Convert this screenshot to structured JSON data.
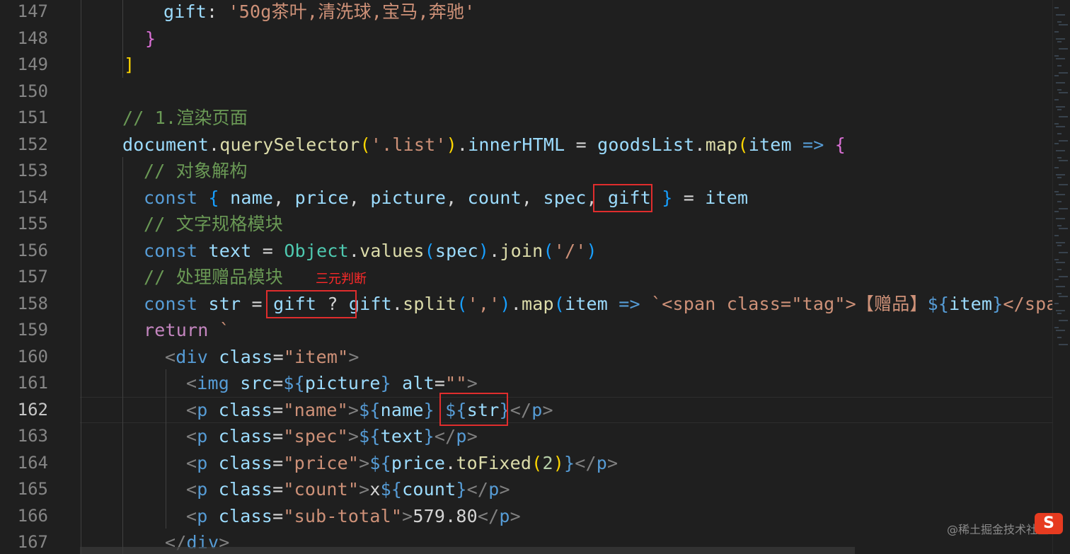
{
  "editor": {
    "lines": [
      {
        "num": "147",
        "segments": [
          [
            "t-var",
            "gift"
          ],
          [
            "t-pun",
            ": "
          ],
          [
            "t-str",
            "'50g茶叶,清洗球,宝马,奔驰'"
          ]
        ]
      },
      {
        "num": "148",
        "segments": [
          [
            "b2",
            "}"
          ]
        ]
      },
      {
        "num": "149",
        "segments": [
          [
            "b1",
            "]"
          ]
        ]
      },
      {
        "num": "150",
        "segments": []
      },
      {
        "num": "151",
        "segments": [
          [
            "t-cm",
            "// 1.渲染页面"
          ]
        ]
      },
      {
        "num": "152",
        "segments": [
          [
            "t-var",
            "document"
          ],
          [
            "t-pun",
            "."
          ],
          [
            "t-fn",
            "querySelector"
          ],
          [
            "b1",
            "("
          ],
          [
            "t-str",
            "'.list'"
          ],
          [
            "b1",
            ")"
          ],
          [
            "t-pun",
            "."
          ],
          [
            "t-var",
            "innerHTML"
          ],
          [
            "t-pun",
            " = "
          ],
          [
            "t-var",
            "goodsList"
          ],
          [
            "t-pun",
            "."
          ],
          [
            "t-fn",
            "map"
          ],
          [
            "b1",
            "("
          ],
          [
            "t-var",
            "item"
          ],
          [
            "t-pun",
            " "
          ],
          [
            "t-kw",
            "=>"
          ],
          [
            "t-pun",
            " "
          ],
          [
            "b2",
            "{"
          ]
        ]
      },
      {
        "num": "153",
        "segments": [
          [
            "t-cm",
            "// 对象解构"
          ]
        ]
      },
      {
        "num": "154",
        "segments": [
          [
            "t-kw",
            "const"
          ],
          [
            "t-pun",
            " "
          ],
          [
            "b3",
            "{"
          ],
          [
            "t-pun",
            " "
          ],
          [
            "t-var",
            "name"
          ],
          [
            "t-pun",
            ", "
          ],
          [
            "t-var",
            "price"
          ],
          [
            "t-pun",
            ", "
          ],
          [
            "t-var",
            "picture"
          ],
          [
            "t-pun",
            ", "
          ],
          [
            "t-var",
            "count"
          ],
          [
            "t-pun",
            ", "
          ],
          [
            "t-var",
            "spec"
          ],
          [
            "t-pun",
            ", "
          ],
          [
            "t-var",
            "gift"
          ],
          [
            "t-pun",
            " "
          ],
          [
            "b3",
            "}"
          ],
          [
            "t-pun",
            " = "
          ],
          [
            "t-var",
            "item"
          ]
        ]
      },
      {
        "num": "155",
        "segments": [
          [
            "t-cm",
            "// 文字规格模块"
          ]
        ]
      },
      {
        "num": "156",
        "segments": [
          [
            "t-kw",
            "const"
          ],
          [
            "t-pun",
            " "
          ],
          [
            "t-var",
            "text"
          ],
          [
            "t-pun",
            " = "
          ],
          [
            "t-cls",
            "Object"
          ],
          [
            "t-pun",
            "."
          ],
          [
            "t-fn",
            "values"
          ],
          [
            "b3",
            "("
          ],
          [
            "t-var",
            "spec"
          ],
          [
            "b3",
            ")"
          ],
          [
            "t-pun",
            "."
          ],
          [
            "t-fn",
            "join"
          ],
          [
            "b3",
            "("
          ],
          [
            "t-str",
            "'/'"
          ],
          [
            "b3",
            ")"
          ]
        ]
      },
      {
        "num": "157",
        "segments": [
          [
            "t-cm",
            "// 处理赠品模块"
          ]
        ]
      },
      {
        "num": "158",
        "segments": [
          [
            "t-kw",
            "const"
          ],
          [
            "t-pun",
            " "
          ],
          [
            "t-var",
            "str"
          ],
          [
            "t-pun",
            " = "
          ],
          [
            "t-var",
            "gift"
          ],
          [
            "t-pun",
            " ? "
          ],
          [
            "t-var",
            "gift"
          ],
          [
            "t-pun",
            "."
          ],
          [
            "t-fn",
            "split"
          ],
          [
            "b3",
            "("
          ],
          [
            "t-str",
            "','"
          ],
          [
            "b3",
            ")"
          ],
          [
            "t-pun",
            "."
          ],
          [
            "t-fn",
            "map"
          ],
          [
            "b3",
            "("
          ],
          [
            "t-var",
            "item"
          ],
          [
            "t-pun",
            " "
          ],
          [
            "t-kw",
            "=>"
          ],
          [
            "t-pun",
            " "
          ],
          [
            "t-str",
            "`<span class=\"tag\">【赠品】"
          ],
          [
            "tpl",
            "${"
          ],
          [
            "t-var",
            "item"
          ],
          [
            "tpl",
            "}"
          ],
          [
            "t-str",
            "</span"
          ]
        ]
      },
      {
        "num": "159",
        "segments": [
          [
            "t-ret",
            "return"
          ],
          [
            "t-pun",
            " "
          ],
          [
            "t-str",
            "`"
          ]
        ]
      },
      {
        "num": "160",
        "segments": [
          [
            "t-tag",
            "<"
          ],
          [
            "t-tagname",
            "div"
          ],
          [
            "t-pun",
            " "
          ],
          [
            "t-var",
            "class"
          ],
          [
            "t-pun",
            "="
          ],
          [
            "t-str",
            "\"item\""
          ],
          [
            "t-tag",
            ">"
          ]
        ]
      },
      {
        "num": "161",
        "segments": [
          [
            "t-tag",
            "<"
          ],
          [
            "t-tagname",
            "img"
          ],
          [
            "t-pun",
            " "
          ],
          [
            "t-var",
            "src"
          ],
          [
            "t-pun",
            "="
          ],
          [
            "tpl",
            "${"
          ],
          [
            "t-var",
            "picture"
          ],
          [
            "tpl",
            "}"
          ],
          [
            "t-pun",
            " "
          ],
          [
            "t-var",
            "alt"
          ],
          [
            "t-pun",
            "="
          ],
          [
            "t-str",
            "\"\""
          ],
          [
            "t-tag",
            ">"
          ]
        ]
      },
      {
        "num": "162",
        "segments": [
          [
            "t-tag",
            "<"
          ],
          [
            "t-tagname",
            "p"
          ],
          [
            "t-pun",
            " "
          ],
          [
            "t-var",
            "class"
          ],
          [
            "t-pun",
            "="
          ],
          [
            "t-str",
            "\"name\""
          ],
          [
            "t-tag",
            ">"
          ],
          [
            "tpl",
            "${"
          ],
          [
            "t-var",
            "name"
          ],
          [
            "tpl",
            "}"
          ],
          [
            "t-pun",
            " "
          ],
          [
            "tpl",
            "${"
          ],
          [
            "t-var",
            "str"
          ],
          [
            "tpl",
            "}"
          ],
          [
            "t-tag",
            "</"
          ],
          [
            "t-tagname",
            "p"
          ],
          [
            "t-tag",
            ">"
          ]
        ]
      },
      {
        "num": "163",
        "segments": [
          [
            "t-tag",
            "<"
          ],
          [
            "t-tagname",
            "p"
          ],
          [
            "t-pun",
            " "
          ],
          [
            "t-var",
            "class"
          ],
          [
            "t-pun",
            "="
          ],
          [
            "t-str",
            "\"spec\""
          ],
          [
            "t-tag",
            ">"
          ],
          [
            "tpl",
            "${"
          ],
          [
            "t-var",
            "text"
          ],
          [
            "tpl",
            "}"
          ],
          [
            "t-tag",
            "</"
          ],
          [
            "t-tagname",
            "p"
          ],
          [
            "t-tag",
            ">"
          ]
        ]
      },
      {
        "num": "164",
        "segments": [
          [
            "t-tag",
            "<"
          ],
          [
            "t-tagname",
            "p"
          ],
          [
            "t-pun",
            " "
          ],
          [
            "t-var",
            "class"
          ],
          [
            "t-pun",
            "="
          ],
          [
            "t-str",
            "\"price\""
          ],
          [
            "t-tag",
            ">"
          ],
          [
            "tpl",
            "${"
          ],
          [
            "t-var",
            "price"
          ],
          [
            "t-pun",
            "."
          ],
          [
            "t-fn",
            "toFixed"
          ],
          [
            "b1",
            "("
          ],
          [
            "t-num",
            "2"
          ],
          [
            "b1",
            ")"
          ],
          [
            "tpl",
            "}"
          ],
          [
            "t-tag",
            "</"
          ],
          [
            "t-tagname",
            "p"
          ],
          [
            "t-tag",
            ">"
          ]
        ]
      },
      {
        "num": "165",
        "segments": [
          [
            "t-tag",
            "<"
          ],
          [
            "t-tagname",
            "p"
          ],
          [
            "t-pun",
            " "
          ],
          [
            "t-var",
            "class"
          ],
          [
            "t-pun",
            "="
          ],
          [
            "t-str",
            "\"count\""
          ],
          [
            "t-tag",
            ">"
          ],
          [
            "t-pun",
            "x"
          ],
          [
            "tpl",
            "${"
          ],
          [
            "t-var",
            "count"
          ],
          [
            "tpl",
            "}"
          ],
          [
            "t-tag",
            "</"
          ],
          [
            "t-tagname",
            "p"
          ],
          [
            "t-tag",
            ">"
          ]
        ]
      },
      {
        "num": "166",
        "segments": [
          [
            "t-tag",
            "<"
          ],
          [
            "t-tagname",
            "p"
          ],
          [
            "t-pun",
            " "
          ],
          [
            "t-var",
            "class"
          ],
          [
            "t-pun",
            "="
          ],
          [
            "t-str",
            "\"sub-total\""
          ],
          [
            "t-tag",
            ">"
          ],
          [
            "t-pun",
            "579.80"
          ],
          [
            "t-tag",
            "</"
          ],
          [
            "t-tagname",
            "p"
          ],
          [
            "t-tag",
            ">"
          ]
        ]
      },
      {
        "num": "167",
        "segments": [
          [
            "t-tag",
            "</"
          ],
          [
            "t-tagname",
            "div"
          ],
          [
            "t-tag",
            ">"
          ]
        ]
      }
    ],
    "active_line": "162"
  },
  "annotation": {
    "label": "三元判断"
  },
  "watermark": {
    "text": "@稀土掘金技术社区",
    "logo": "S"
  },
  "colors": {
    "background": "#1f1f1f",
    "highlight_box": "#e02d2d"
  }
}
